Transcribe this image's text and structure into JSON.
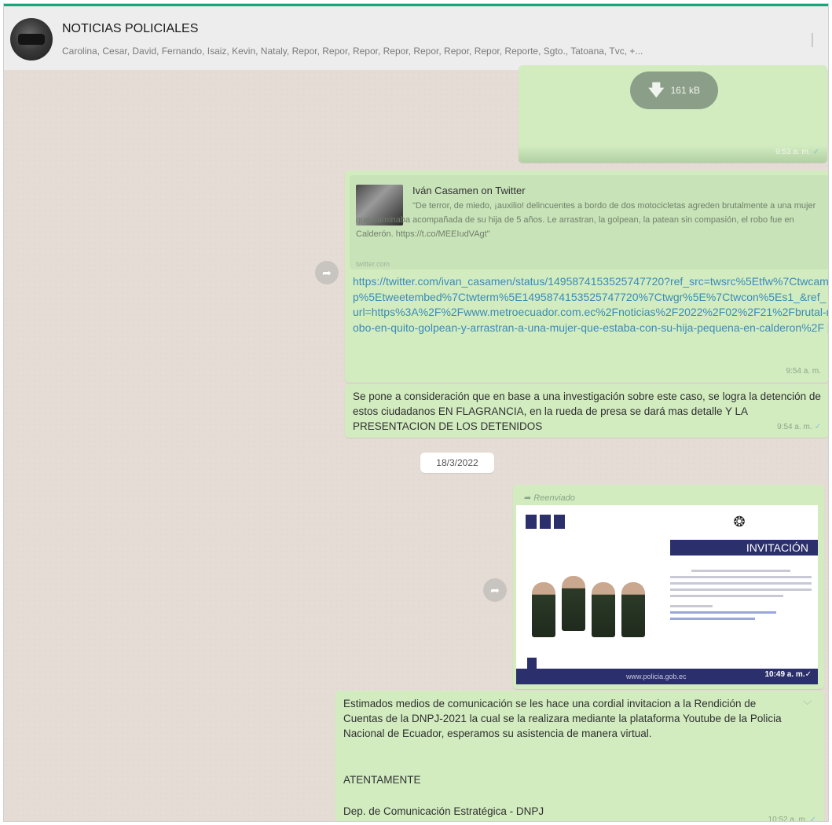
{
  "header": {
    "title": "NOTICIAS POLICIALES",
    "participants": "Carolina, Cesar, David, Fernando, Isaiz, Kevin, Nataly, Repor, Repor, Repor, Repor, Repor, Repor, Repor, Reporte, Sgto., Tatoana, Tvc, +..."
  },
  "messages": {
    "file": {
      "size": "161 kB",
      "time": "9:53 a. m."
    },
    "link": {
      "preview_title": "Iván Casamen on Twitter",
      "preview_desc": "\"De terror, de miedo, ¡auxilio! delincuentes a bordo de dos motocicletas agreden brutalmente a una mujer que caminaba acompañada de su hija de 5 años. Le arrastran, la golpean, la patean sin compasión, el robo fue en Calderón. https://t.co/MEEIudVAgt\"",
      "preview_domain": "twitter.com",
      "url": "https://twitter.com/ivan_casamen/status/1495874153525747720?ref_src=twsrc%5Etfw%7Ctwcamp%5Etweetembed%7Ctwterm%5E1495874153525747720%7Ctwgr%5E%7Ctwcon%5Es1_&ref_url=https%3A%2F%2Fwww.metroecuador.com.ec%2Fnoticias%2F2022%2F02%2F21%2Fbrutal-robo-en-quito-golpean-y-arrastran-a-una-mujer-que-estaba-con-su-hija-pequena-en-calderon%2F [",
      "time": "9:54 a. m."
    },
    "note": {
      "text": "Se pone a consideración que en base a una investigación sobre este caso, se logra la detención de estos ciudadanos EN FLAGRANCIA, en la rueda de presa se dará mas detalle Y LA PRESENTACION DE LOS DETENIDOS",
      "time": "9:54 a. m."
    },
    "date_chip": "18/3/2022",
    "forwarded": {
      "label": "Reenviado",
      "image_heading": "INVITACIÓN",
      "image_footer": "www.policia.gob.ec",
      "time": "10:49 a. m."
    },
    "invitation": {
      "paragraph": "Estimados medios de comunicación se les hace una cordial invitacion a la Rendición de Cuentas de la DNPJ-2021 la cual se la realizara mediante la plataforma Youtube de la Policia Nacional de Ecuador, esperamos su asistencia de manera virtual.",
      "closing": "ATENTAMENTE",
      "signature": "Dep. de Comunicación Estratégica - DNPJ",
      "time": "10:52 a. m."
    }
  },
  "colors": {
    "bubble_out": "#d2ecc0",
    "chat_bg": "#e5ddd5",
    "header_accent": "#19a67a",
    "invite_navy": "#2b2f6b"
  },
  "icons": [
    "download-icon",
    "forward-icon",
    "read-check-icon",
    "chevron-down-icon",
    "menu-kebab-icon"
  ]
}
